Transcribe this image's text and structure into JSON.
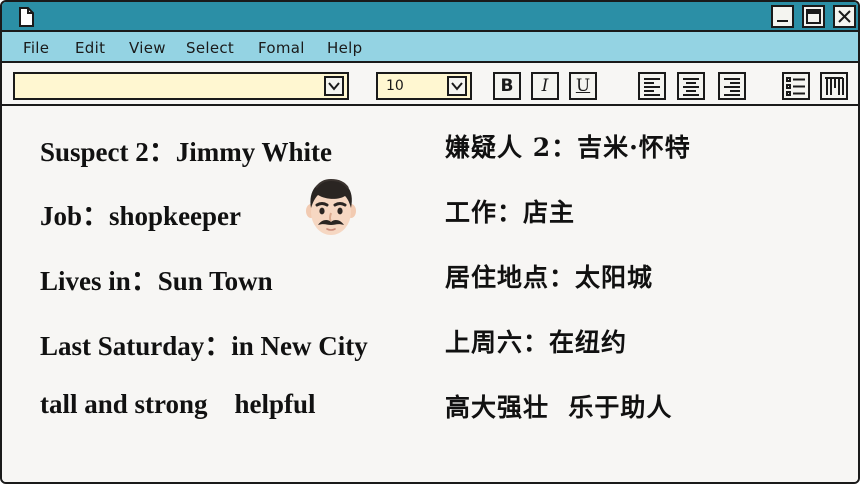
{
  "menu": {
    "items": [
      "File",
      "Edit",
      "View",
      "Select",
      "Fomal",
      "Help"
    ]
  },
  "toolbar": {
    "font_value": "",
    "size_value": "10",
    "bold_label": "B",
    "italic_label": "I",
    "underline_label": "U"
  },
  "document": {
    "en": {
      "name": "Suspect 2：Jimmy White",
      "job": "Job：shopkeeper",
      "lives": "Lives in：Sun Town",
      "last_saturday": "Last Saturday：in New City",
      "traits": "tall and strong    helpful"
    },
    "zh": {
      "name": "嫌疑人 2：吉米·怀特",
      "job": "工作：店主",
      "lives": "居住地点：太阳城",
      "last_saturday": "上周六：在纽约",
      "traits": "高大强壮  乐于助人"
    }
  },
  "icons": {
    "document": "document-icon",
    "avatar": "man-with-mustache-icon"
  },
  "colors": {
    "titlebar": "#2b8fa6",
    "menubar": "#94d3e3",
    "input_fill": "#fff7d1",
    "page": "#f7f6f4"
  }
}
